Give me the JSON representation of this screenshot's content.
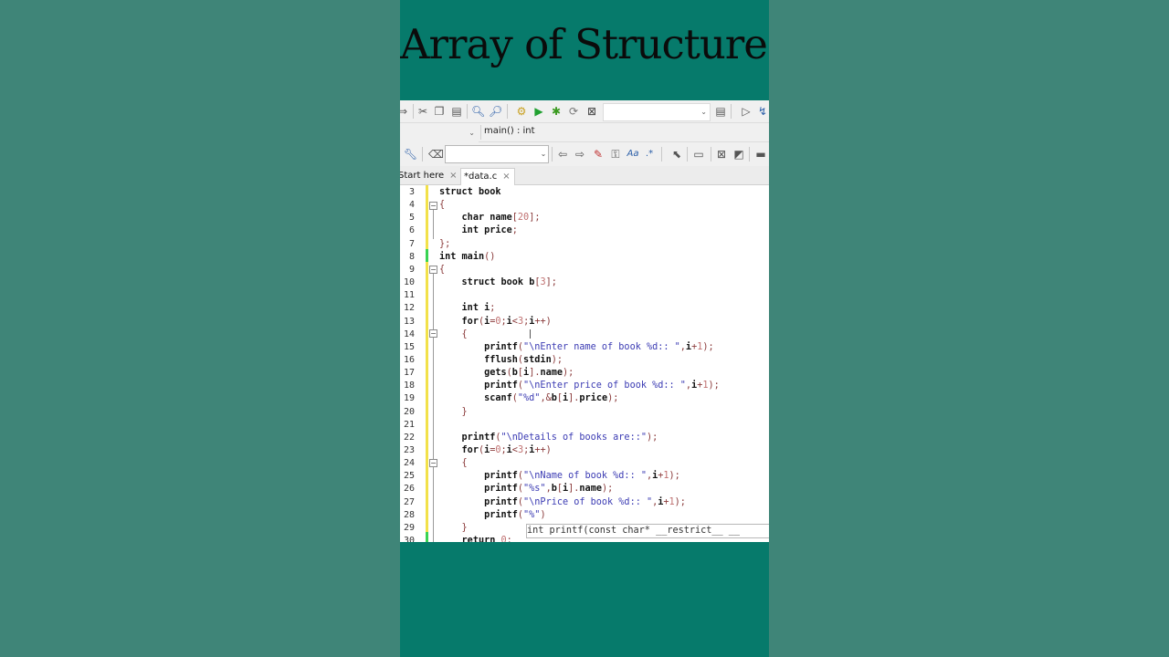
{
  "title": "Array of Structures",
  "toolbar": {
    "icons": [
      "arrow-icon",
      "cut-icon",
      "copy-icon",
      "paste-icon",
      "find-icon",
      "find-replace-icon",
      "build-icon",
      "run-icon",
      "build-run-icon",
      "rebuild-icon",
      "abort-icon",
      "build-target-combo",
      "select-target-icon",
      "debug-run-icon",
      "debug-step-icon"
    ]
  },
  "scope": {
    "function": "main() : int"
  },
  "search_toolbar": {
    "icons": [
      "wrench-icon",
      "find-tag-icon",
      "prev-icon",
      "next-icon",
      "highlight-icon",
      "selected-text-icon",
      "match-case-icon",
      "regex-icon",
      "pointer-icon",
      "rectangle-icon",
      "sheet-icon",
      "image-icon",
      "block-icon"
    ],
    "combo_value": ""
  },
  "tabs": [
    {
      "label": "Start here",
      "close": "×"
    },
    {
      "label": "*data.c",
      "close": "×"
    }
  ],
  "code_lines": [
    {
      "n": "3",
      "html": "<span class=\"kw\">struct</span> <span class=\"kw\">book</span>"
    },
    {
      "n": "4",
      "html": "<span class=\"op\">{</span>"
    },
    {
      "n": "5",
      "html": "    <span class=\"kw\">char</span> <span class=\"kw\">name</span><span class=\"op\">[</span><span class=\"num\">20</span><span class=\"op\">];</span>"
    },
    {
      "n": "6",
      "html": "    <span class=\"kw\">int</span> <span class=\"kw\">price</span><span class=\"op\">;</span>"
    },
    {
      "n": "7",
      "html": "<span class=\"op\">};</span>"
    },
    {
      "n": "8",
      "html": "<span class=\"kw\">int</span> <span class=\"kw\">main</span><span class=\"op\">()</span>"
    },
    {
      "n": "9",
      "html": "<span class=\"op\">{</span>"
    },
    {
      "n": "10",
      "html": "    <span class=\"kw\">struct</span> <span class=\"kw\">book</span> <span class=\"kw\">b</span><span class=\"op\">[</span><span class=\"num\">3</span><span class=\"op\">];</span>"
    },
    {
      "n": "11",
      "html": ""
    },
    {
      "n": "12",
      "html": "    <span class=\"kw\">int</span> <span class=\"kw\">i</span><span class=\"op\">;</span>"
    },
    {
      "n": "13",
      "html": "    <span class=\"kw\">for</span><span class=\"op\">(</span><span class=\"kw\">i</span><span class=\"op\">=</span><span class=\"num\">0</span><span class=\"op\">;</span><span class=\"kw\">i</span><span class=\"op\">&lt;</span><span class=\"num\">3</span><span class=\"op\">;</span><span class=\"kw\">i</span><span class=\"op\">++)</span>"
    },
    {
      "n": "14",
      "html": "    <span class=\"op\">{</span>"
    },
    {
      "n": "15",
      "html": "        <span class=\"kw\">printf</span><span class=\"op\">(</span><span class=\"str\">\"\\nEnter name of book %d:: \"</span><span class=\"op\">,</span><span class=\"kw\">i</span><span class=\"op\">+</span><span class=\"num\">1</span><span class=\"op\">);</span>"
    },
    {
      "n": "16",
      "html": "        <span class=\"kw\">fflush</span><span class=\"op\">(</span><span class=\"kw\">stdin</span><span class=\"op\">);</span>"
    },
    {
      "n": "17",
      "html": "        <span class=\"kw\">gets</span><span class=\"op\">(</span><span class=\"kw\">b</span><span class=\"op\">[</span><span class=\"kw\">i</span><span class=\"op\">].</span><span class=\"kw\">name</span><span class=\"op\">);</span>"
    },
    {
      "n": "18",
      "html": "        <span class=\"kw\">printf</span><span class=\"op\">(</span><span class=\"str\">\"\\nEnter price of book %d:: \"</span><span class=\"op\">,</span><span class=\"kw\">i</span><span class=\"op\">+</span><span class=\"num\">1</span><span class=\"op\">);</span>"
    },
    {
      "n": "19",
      "html": "        <span class=\"kw\">scanf</span><span class=\"op\">(</span><span class=\"str\">\"%d\"</span><span class=\"op\">,&amp;</span><span class=\"kw\">b</span><span class=\"op\">[</span><span class=\"kw\">i</span><span class=\"op\">].</span><span class=\"kw\">price</span><span class=\"op\">);</span>"
    },
    {
      "n": "20",
      "html": "    <span class=\"op\">}</span>"
    },
    {
      "n": "21",
      "html": ""
    },
    {
      "n": "22",
      "html": "    <span class=\"kw\">printf</span><span class=\"op\">(</span><span class=\"str\">\"\\nDetails of books are::\"</span><span class=\"op\">);</span>"
    },
    {
      "n": "23",
      "html": "    <span class=\"kw\">for</span><span class=\"op\">(</span><span class=\"kw\">i</span><span class=\"op\">=</span><span class=\"num\">0</span><span class=\"op\">;</span><span class=\"kw\">i</span><span class=\"op\">&lt;</span><span class=\"num\">3</span><span class=\"op\">;</span><span class=\"kw\">i</span><span class=\"op\">++)</span>"
    },
    {
      "n": "24",
      "html": "    <span class=\"op\">{</span>"
    },
    {
      "n": "25",
      "html": "        <span class=\"kw\">printf</span><span class=\"op\">(</span><span class=\"str\">\"\\nName of book %d:: \"</span><span class=\"op\">,</span><span class=\"kw\">i</span><span class=\"op\">+</span><span class=\"num\">1</span><span class=\"op\">);</span>"
    },
    {
      "n": "26",
      "html": "        <span class=\"kw\">printf</span><span class=\"op\">(</span><span class=\"str\">\"%s\"</span><span class=\"op\">,</span><span class=\"kw\">b</span><span class=\"op\">[</span><span class=\"kw\">i</span><span class=\"op\">].</span><span class=\"kw\">name</span><span class=\"op\">);</span>"
    },
    {
      "n": "27",
      "html": "        <span class=\"kw\">printf</span><span class=\"op\">(</span><span class=\"str\">\"\\nPrice of book %d:: \"</span><span class=\"op\">,</span><span class=\"kw\">i</span><span class=\"op\">+</span><span class=\"num\">1</span><span class=\"op\">);</span>"
    },
    {
      "n": "28",
      "html": "        <span class=\"kw\">printf</span><span class=\"op\">(</span><span class=\"str\">\"%\"</span><span class=\"op\">)</span>"
    },
    {
      "n": "29",
      "html": "    <span class=\"op\">}</span>"
    },
    {
      "n": "30",
      "html": "    <span class=\"kw\">return</span> <span class=\"num\">0</span><span class=\"op\">;</span>"
    }
  ],
  "calltip": "int printf(const char* __restrict__ __",
  "colors": {
    "background": "#3f8578",
    "panel": "#067a6b",
    "changed_yellow": "#f2e14a",
    "saved_green": "#39d353"
  }
}
